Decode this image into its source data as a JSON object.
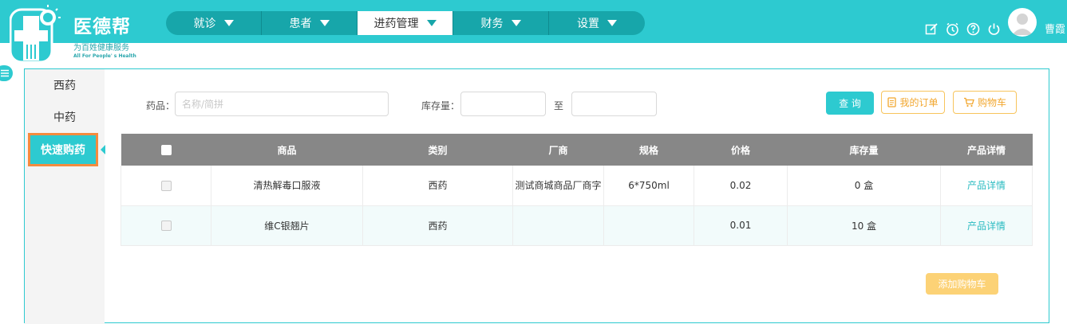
{
  "brand": {
    "name": "医德帮",
    "slogan": "为百姓健康服务",
    "slogan_en": "All For People' s Health"
  },
  "nav": {
    "items": [
      {
        "label": "就诊"
      },
      {
        "label": "患者"
      },
      {
        "label": "进药管理",
        "active": true
      },
      {
        "label": "财务"
      },
      {
        "label": "设置"
      }
    ]
  },
  "header": {
    "icons": [
      "edit-icon",
      "clock-icon",
      "help-icon",
      "power-icon"
    ],
    "username": "曹霞"
  },
  "sidebar": {
    "items": [
      {
        "label": "西药"
      },
      {
        "label": "中药"
      },
      {
        "label": "快速购药",
        "active": true
      }
    ]
  },
  "filters": {
    "drug_label": "药品：",
    "drug_placeholder": "名称/简拼",
    "stock_label": "库存量：",
    "stock_from_value": "",
    "to_label": "至",
    "stock_to_value": ""
  },
  "buttons": {
    "query": "查 询",
    "my_orders": "我的订单",
    "cart": "购物车",
    "add_to_cart": "添加购物车"
  },
  "table": {
    "columns": [
      "商品",
      "类别",
      "厂商",
      "规格",
      "价格",
      "库存量",
      "产品详情"
    ],
    "rows": [
      {
        "name": "清热解毒口服液",
        "category": "西药",
        "maker": "测试商城商品厂商字",
        "spec": "6*750ml",
        "price": "0.02",
        "stock": "0 盒",
        "detail": "产品详情"
      },
      {
        "name": "维C银翘片",
        "category": "西药",
        "maker": "",
        "spec": "",
        "price": "0.01",
        "stock": "10 盒",
        "detail": "产品详情"
      }
    ]
  },
  "colors": {
    "primary": "#2dcad0",
    "nav_dark": "#17a6aa",
    "table_header": "#878787",
    "accent_orange": "#f58b3e",
    "button_yellow": "#fcd276"
  }
}
